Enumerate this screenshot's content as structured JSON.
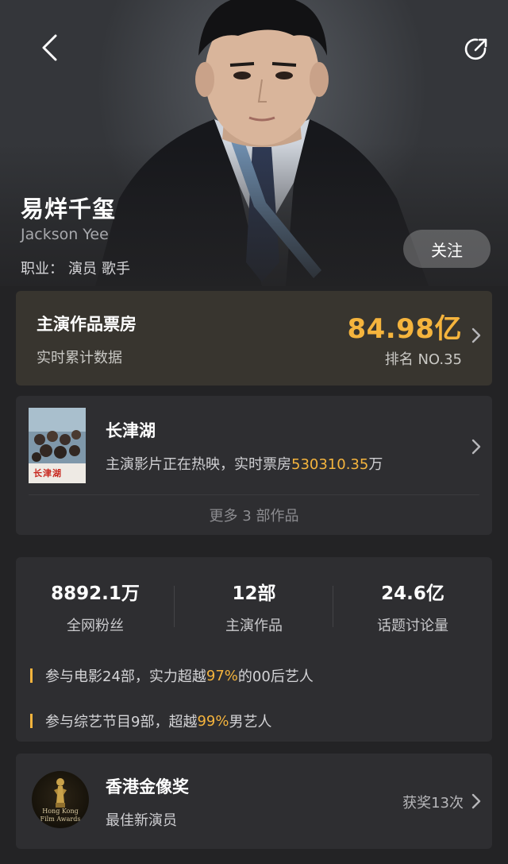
{
  "header": {
    "back_icon": "chevron-left-icon",
    "share_icon": "share-icon"
  },
  "profile": {
    "name_cn": "易烊千玺",
    "name_en": "Jackson Yee",
    "profession_label": "职业：",
    "professions": [
      "演员",
      "歌手"
    ],
    "follow_label": "关注"
  },
  "box_office": {
    "title": "主演作品票房",
    "subtitle": "实时累计数据",
    "value": "84.98亿",
    "rank": "排名 NO.35"
  },
  "current_movie": {
    "title": "长津湖",
    "status_text": "主演影片正在热映，实时票房",
    "box_office": "530310.35",
    "unit": "万",
    "poster_title": "长津湖",
    "more_label": "更多 3 部作品"
  },
  "stats": [
    {
      "value": "8892.1万",
      "label": "全网粉丝"
    },
    {
      "value": "12部",
      "label": "主演作品"
    },
    {
      "value": "24.6亿",
      "label": "话题讨论量"
    }
  ],
  "notes": [
    {
      "before": "参与电影24部，实力超越 ",
      "highlight": "97%",
      "after": " 的00后艺人"
    },
    {
      "before": "参与综艺节目9部，超越 ",
      "highlight": "99%",
      "after": " 男艺人"
    }
  ],
  "award": {
    "title": "香港金像奖",
    "subtitle": "最佳新演员",
    "count": "获奖13次",
    "logo_text_line1": "Hong Kong",
    "logo_text_line2": "Film Awards"
  },
  "colors": {
    "accent": "#f5b43d",
    "background": "#232325",
    "card": "#2e2e31",
    "box_office_card": "#38352f"
  }
}
